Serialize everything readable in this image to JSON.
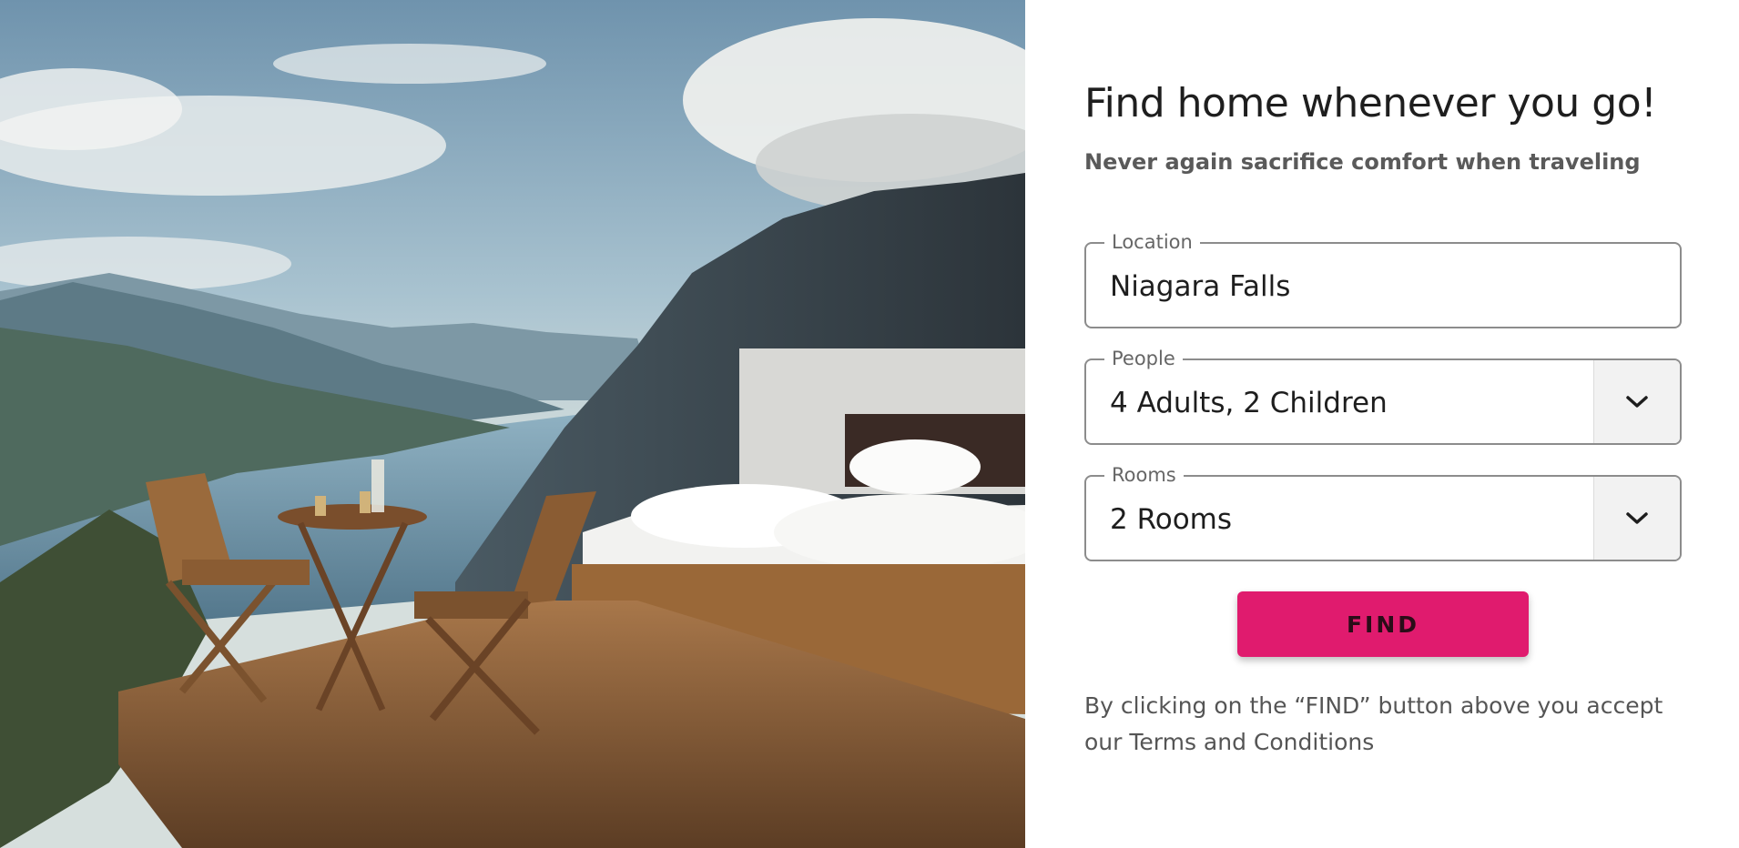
{
  "hero": {
    "image_description_icon": "photo-icon"
  },
  "form": {
    "headline": "Find home whenever you go!",
    "subheadline": "Never again sacrifice comfort when traveling",
    "location": {
      "label": "Location",
      "value": "Niagara Falls"
    },
    "people": {
      "label": "People",
      "value": "4 Adults, 2 Children",
      "icon": "chevron-down-icon"
    },
    "rooms": {
      "label": "Rooms",
      "value": "2 Rooms",
      "icon": "chevron-down-icon"
    },
    "find_label": "FIND",
    "terms_text": "By clicking on the “FIND” button above you accept our Terms and Conditions"
  },
  "colors": {
    "accent": "#e01b6e",
    "border": "#8c8c8c",
    "addon_bg": "#f2f2f2"
  }
}
